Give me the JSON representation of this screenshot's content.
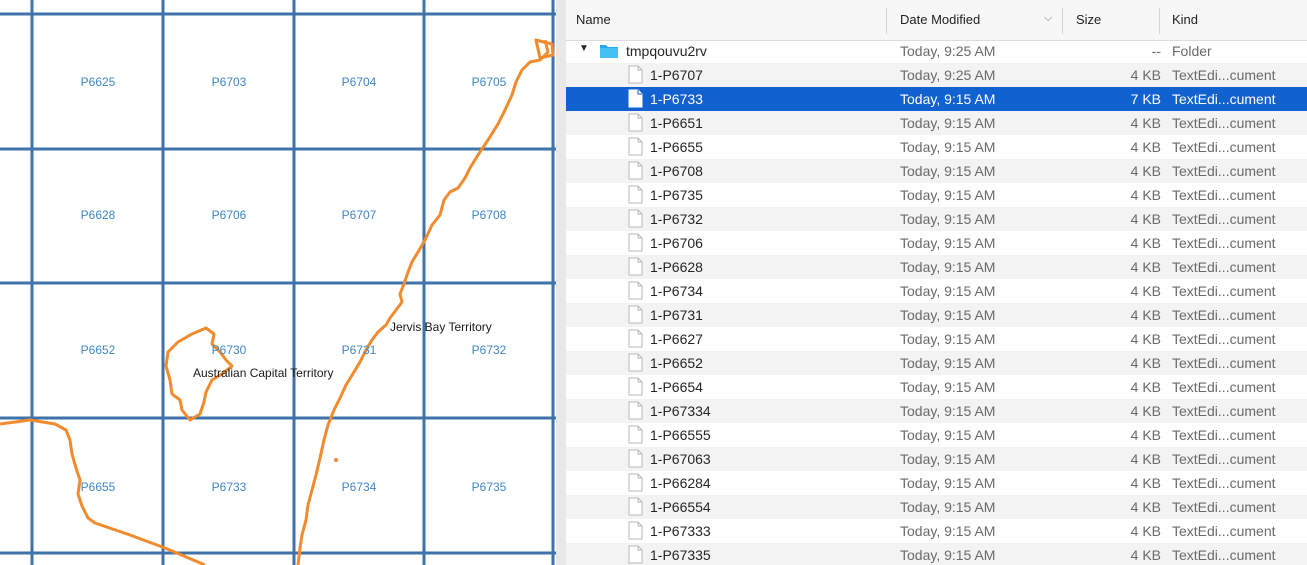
{
  "map": {
    "cells": [
      {
        "row": 0,
        "col": 0,
        "label": "P6625"
      },
      {
        "row": 0,
        "col": 1,
        "label": "P6703"
      },
      {
        "row": 0,
        "col": 2,
        "label": "P6704"
      },
      {
        "row": 0,
        "col": 3,
        "label": "P6705"
      },
      {
        "row": 1,
        "col": 0,
        "label": "P6628"
      },
      {
        "row": 1,
        "col": 1,
        "label": "P6706"
      },
      {
        "row": 1,
        "col": 2,
        "label": "P6707"
      },
      {
        "row": 1,
        "col": 3,
        "label": "P6708"
      },
      {
        "row": 2,
        "col": 0,
        "label": "P6652"
      },
      {
        "row": 2,
        "col": 1,
        "label": "P6730"
      },
      {
        "row": 2,
        "col": 2,
        "label": "P6731"
      },
      {
        "row": 2,
        "col": 3,
        "label": "P6732"
      },
      {
        "row": 3,
        "col": 0,
        "label": "P6655"
      },
      {
        "row": 3,
        "col": 1,
        "label": "P6733"
      },
      {
        "row": 3,
        "col": 2,
        "label": "P6734"
      },
      {
        "row": 3,
        "col": 3,
        "label": "P6735"
      }
    ],
    "regions": {
      "act": "Australian Capital Territory",
      "jervis": "Jervis Bay Territory"
    },
    "colors": {
      "grid": "#3f72a8",
      "boundary": "#f28a2e",
      "label": "#3f87c8"
    }
  },
  "finder": {
    "columns": {
      "name": "Name",
      "date": "Date Modified",
      "size": "Size",
      "kind": "Kind"
    },
    "folder": {
      "name": "tmpqouvu2rv",
      "date": "Today, 9:25 AM",
      "size": "--",
      "kind": "Folder"
    },
    "files": [
      {
        "name": "1-P6707",
        "date": "Today, 9:25 AM",
        "size": "4 KB",
        "kind": "TextEdi...cument",
        "selected": false
      },
      {
        "name": "1-P6733",
        "date": "Today, 9:15 AM",
        "size": "7 KB",
        "kind": "TextEdi...cument",
        "selected": true
      },
      {
        "name": "1-P6651",
        "date": "Today, 9:15 AM",
        "size": "4 KB",
        "kind": "TextEdi...cument",
        "selected": false
      },
      {
        "name": "1-P6655",
        "date": "Today, 9:15 AM",
        "size": "4 KB",
        "kind": "TextEdi...cument",
        "selected": false
      },
      {
        "name": "1-P6708",
        "date": "Today, 9:15 AM",
        "size": "4 KB",
        "kind": "TextEdi...cument",
        "selected": false
      },
      {
        "name": "1-P6735",
        "date": "Today, 9:15 AM",
        "size": "4 KB",
        "kind": "TextEdi...cument",
        "selected": false
      },
      {
        "name": "1-P6732",
        "date": "Today, 9:15 AM",
        "size": "4 KB",
        "kind": "TextEdi...cument",
        "selected": false
      },
      {
        "name": "1-P6706",
        "date": "Today, 9:15 AM",
        "size": "4 KB",
        "kind": "TextEdi...cument",
        "selected": false
      },
      {
        "name": "1-P6628",
        "date": "Today, 9:15 AM",
        "size": "4 KB",
        "kind": "TextEdi...cument",
        "selected": false
      },
      {
        "name": "1-P6734",
        "date": "Today, 9:15 AM",
        "size": "4 KB",
        "kind": "TextEdi...cument",
        "selected": false
      },
      {
        "name": "1-P6731",
        "date": "Today, 9:15 AM",
        "size": "4 KB",
        "kind": "TextEdi...cument",
        "selected": false
      },
      {
        "name": "1-P6627",
        "date": "Today, 9:15 AM",
        "size": "4 KB",
        "kind": "TextEdi...cument",
        "selected": false
      },
      {
        "name": "1-P6652",
        "date": "Today, 9:15 AM",
        "size": "4 KB",
        "kind": "TextEdi...cument",
        "selected": false
      },
      {
        "name": "1-P6654",
        "date": "Today, 9:15 AM",
        "size": "4 KB",
        "kind": "TextEdi...cument",
        "selected": false
      },
      {
        "name": "1-P67334",
        "date": "Today, 9:15 AM",
        "size": "4 KB",
        "kind": "TextEdi...cument",
        "selected": false
      },
      {
        "name": "1-P66555",
        "date": "Today, 9:15 AM",
        "size": "4 KB",
        "kind": "TextEdi...cument",
        "selected": false
      },
      {
        "name": "1-P67063",
        "date": "Today, 9:15 AM",
        "size": "4 KB",
        "kind": "TextEdi...cument",
        "selected": false
      },
      {
        "name": "1-P66284",
        "date": "Today, 9:15 AM",
        "size": "4 KB",
        "kind": "TextEdi...cument",
        "selected": false
      },
      {
        "name": "1-P66554",
        "date": "Today, 9:15 AM",
        "size": "4 KB",
        "kind": "TextEdi...cument",
        "selected": false
      },
      {
        "name": "1-P67333",
        "date": "Today, 9:15 AM",
        "size": "4 KB",
        "kind": "TextEdi...cument",
        "selected": false
      },
      {
        "name": "1-P67335",
        "date": "Today, 9:15 AM",
        "size": "4 KB",
        "kind": "TextEdi...cument",
        "selected": false
      }
    ]
  }
}
